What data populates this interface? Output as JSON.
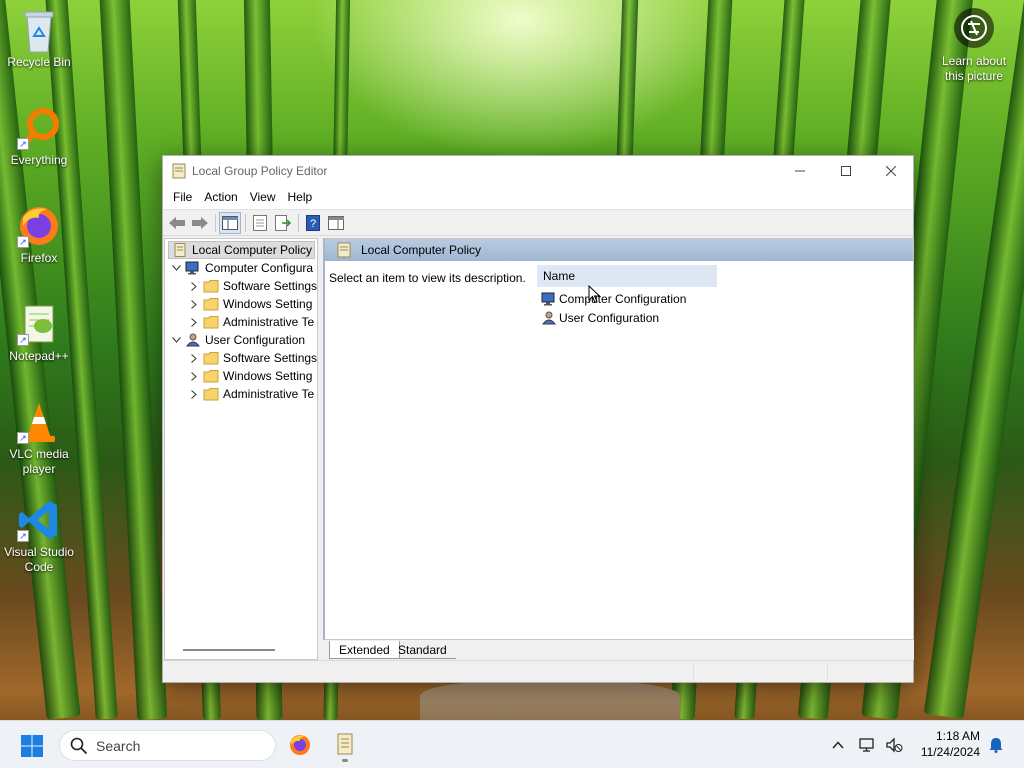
{
  "desktop": {
    "icons": [
      {
        "label": "Recycle Bin"
      },
      {
        "label": "Everything"
      },
      {
        "label": "Firefox"
      },
      {
        "label": "Notepad++"
      },
      {
        "label": "VLC media player"
      },
      {
        "label": "Visual Studio Code"
      }
    ],
    "learn_about": "Learn about this picture"
  },
  "window": {
    "title": "Local Group Policy Editor",
    "menu": [
      "File",
      "Action",
      "View",
      "Help"
    ],
    "tree": {
      "root": "Local Computer Policy",
      "computer_config": "Computer Configura",
      "user_config": "User Configuration",
      "computer_children": [
        "Software Settings",
        "Windows Setting",
        "Administrative Te"
      ],
      "user_children": [
        "Software Settings",
        "Windows Setting",
        "Administrative Te"
      ]
    },
    "right": {
      "header": "Local Computer Policy",
      "description": "Select an item to view its description.",
      "column_name": "Name",
      "items": [
        "Computer Configuration",
        "User Configuration"
      ]
    },
    "tabs": [
      "Extended",
      "Standard"
    ]
  },
  "taskbar": {
    "search_placeholder": "Search",
    "time": "1:18 AM",
    "date": "11/24/2024"
  }
}
